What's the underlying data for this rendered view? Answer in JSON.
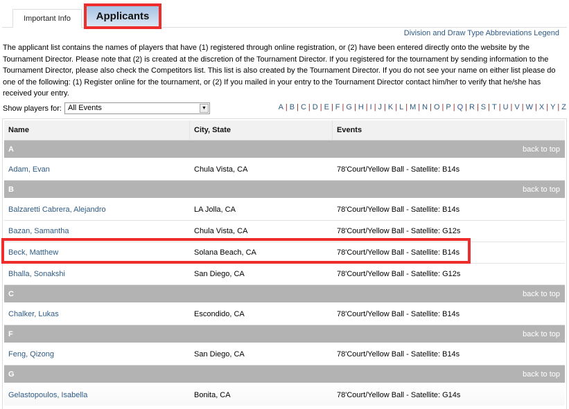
{
  "tabs": [
    {
      "label": "Important Info",
      "active": false
    },
    {
      "label": "Applicants",
      "active": true
    }
  ],
  "legend_link": "Division and Draw Type Abbreviations Legend",
  "intro_text": "The applicant list contains the names of players that have (1) registered through online registration, or (2) have been entered directly onto the website by the Tournament Director. Please note that (2) is created at the discretion of the Tournament Director. If you registered for the tournament by sending information to the Tournament Director, please also check the Competitors list. This list is also created by the Tournament Director. If you do not see your name on either list please do one of the following: (1) Register online for the tournament, or (2) If you mailed in your entry to the Tournament Director contact him/her to verify that he/she has received your entry.",
  "filter": {
    "label": "Show players for:",
    "selected": "All Events",
    "arrow_icon": "▼"
  },
  "alphabet": [
    "A",
    "B",
    "C",
    "D",
    "E",
    "F",
    "G",
    "H",
    "I",
    "J",
    "K",
    "L",
    "M",
    "N",
    "O",
    "P",
    "Q",
    "R",
    "S",
    "T",
    "U",
    "V",
    "W",
    "X",
    "Y",
    "Z"
  ],
  "table": {
    "headers": {
      "name": "Name",
      "city": "City, State",
      "events": "Events"
    },
    "back_to_top": "back to top",
    "groups": [
      {
        "letter": "A",
        "rows": [
          {
            "name": "Adam, Evan",
            "city": "Chula Vista, CA",
            "events": "78'Court/Yellow Ball - Satellite: B14s"
          }
        ]
      },
      {
        "letter": "B",
        "rows": [
          {
            "name": "Balzaretti Cabrera, Alejandro",
            "city": "LA Jolla, CA",
            "events": "78'Court/Yellow Ball - Satellite: B14s"
          },
          {
            "name": "Bazan, Samantha",
            "city": "Chula Vista, CA",
            "events": "78'Court/Yellow Ball - Satellite: G12s"
          },
          {
            "name": "Beck, Matthew",
            "city": "Solana Beach, CA",
            "events": "78'Court/Yellow Ball - Satellite: B14s",
            "highlighted": true
          },
          {
            "name": "Bhalla, Sonakshi",
            "city": "San Diego, CA",
            "events": "78'Court/Yellow Ball - Satellite: G12s"
          }
        ]
      },
      {
        "letter": "C",
        "rows": [
          {
            "name": "Chalker, Lukas",
            "city": "Escondido, CA",
            "events": "78'Court/Yellow Ball - Satellite: B14s"
          }
        ]
      },
      {
        "letter": "F",
        "rows": [
          {
            "name": "Feng, Qizong",
            "city": "San Diego, CA",
            "events": "78'Court/Yellow Ball - Satellite: B14s"
          }
        ]
      },
      {
        "letter": "G",
        "rows": [
          {
            "name": "Gelastopoulos, Isabella",
            "city": "Bonita, CA",
            "events": "78'Court/Yellow Ball - Satellite: G14s"
          }
        ]
      }
    ]
  },
  "colors": {
    "link": "#2e5a84",
    "highlight_border": "#ee2d2d",
    "group_bg": "#b3b3b3",
    "alpha_separator": "#8b2a2a"
  }
}
